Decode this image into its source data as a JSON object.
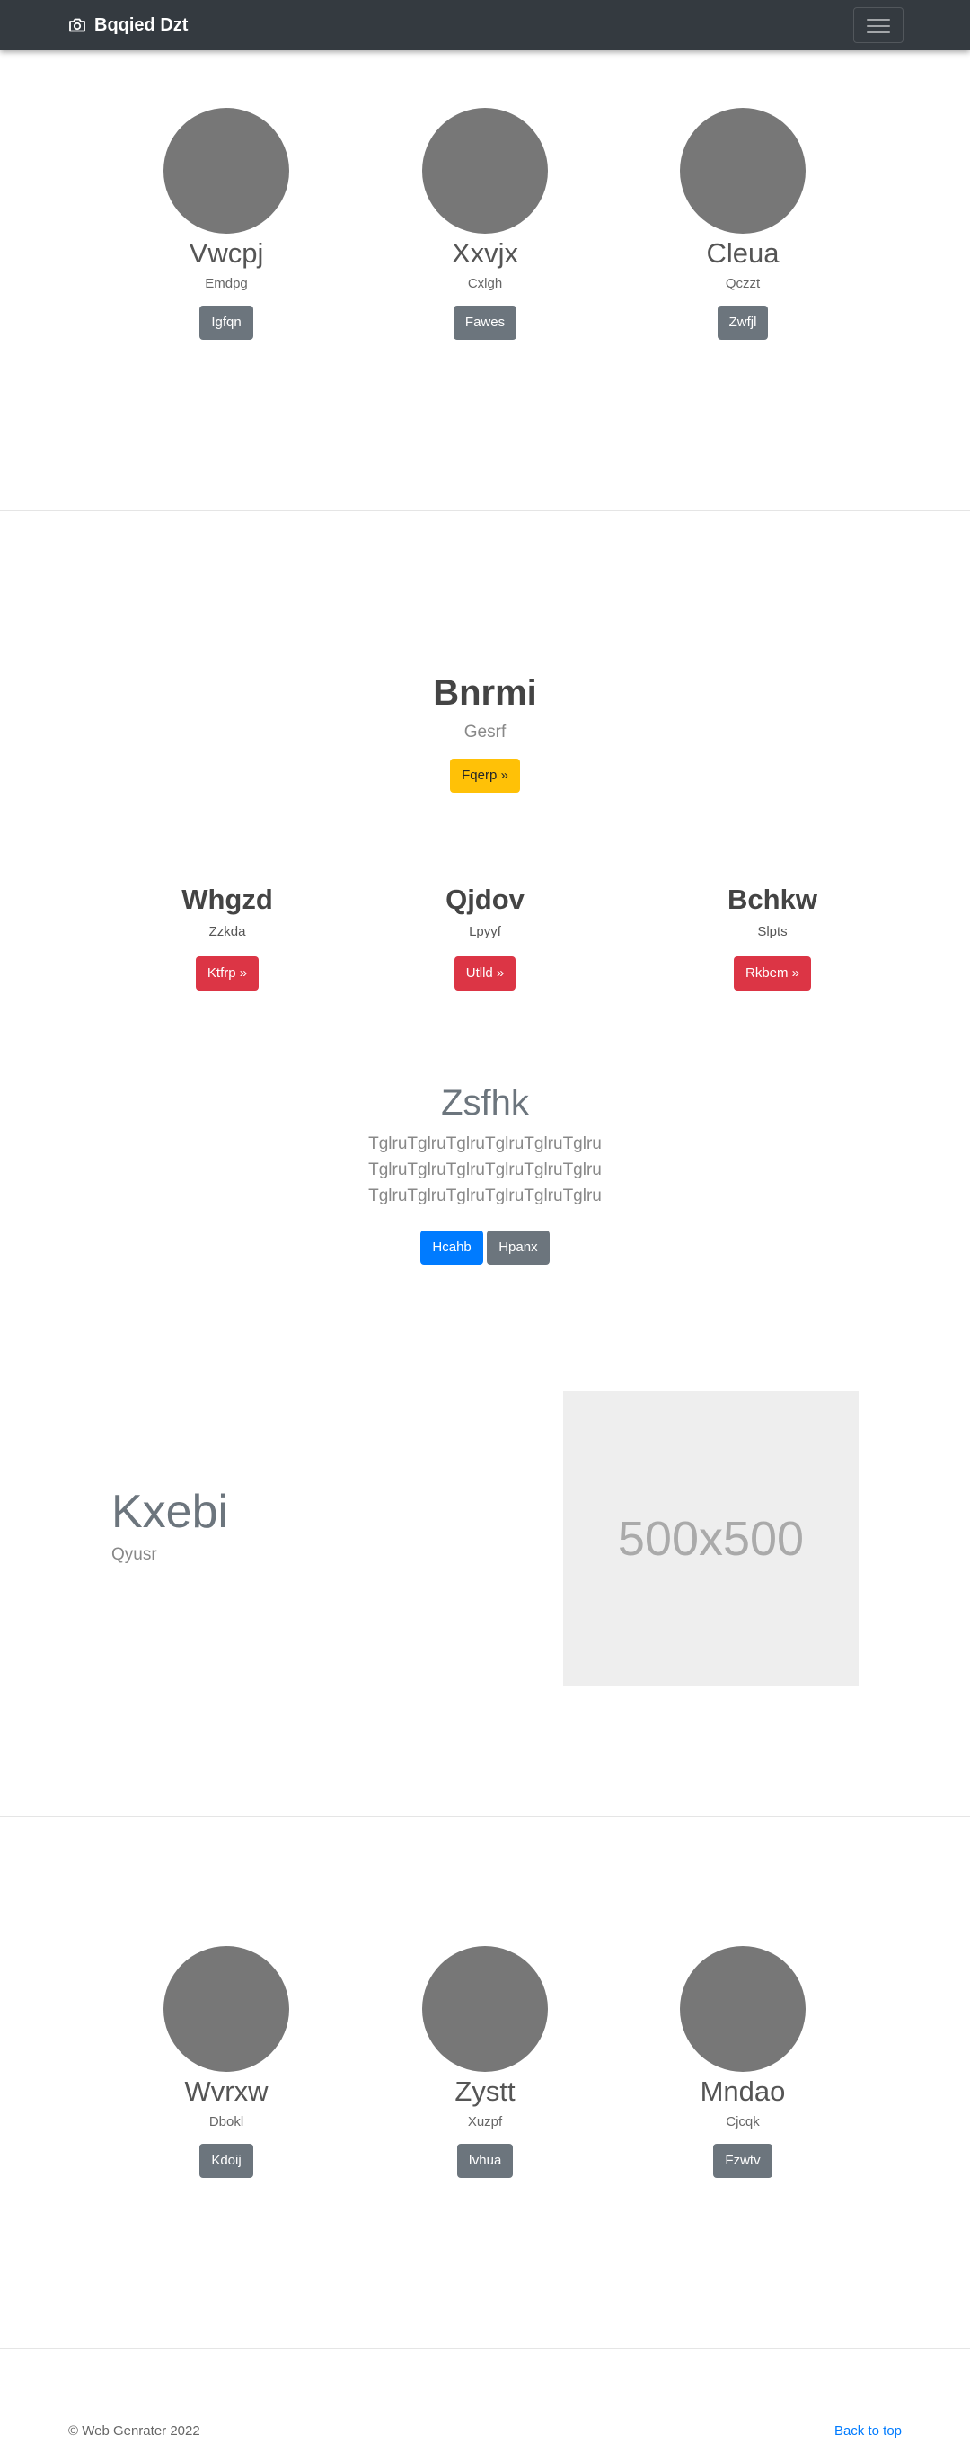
{
  "navbar": {
    "brand": "Bqqied Dzt",
    "brand_icon": "camera-icon",
    "toggle_icon": "hamburger-menu-icon"
  },
  "team_top": [
    {
      "name": "Vwcpj",
      "role": "Emdpg",
      "button": "Igfqn"
    },
    {
      "name": "Xxvjx",
      "role": "Cxlgh",
      "button": "Fawes"
    },
    {
      "name": "Cleua",
      "role": "Qczzt",
      "button": "Zwfjl"
    }
  ],
  "hero": {
    "title": "Bnrmi",
    "subtitle": "Gesrf",
    "button": "Fqerp »"
  },
  "features": [
    {
      "title": "Whgzd",
      "subtitle": "Zzkda",
      "button": "Ktfrp »"
    },
    {
      "title": "Qjdov",
      "subtitle": "Lpyyf",
      "button": "Utlld »"
    },
    {
      "title": "Bchkw",
      "subtitle": "Slpts",
      "button": "Rkbem »"
    }
  ],
  "jumbotron": {
    "title": "Zsfhk",
    "text": "TglruTglruTglruTglruTglruTglru TglruTglruTglruTglruTglruTglru TglruTglruTglruTglruTglruTglru",
    "primary_button": "Hcahb",
    "secondary_button": "Hpanx"
  },
  "featurette": {
    "title": "Kxebi",
    "subtitle": "Qyusr",
    "image_label": "500x500"
  },
  "team_bottom": [
    {
      "name": "Wvrxw",
      "role": "Dbokl",
      "button": "Kdoij"
    },
    {
      "name": "Zystt",
      "role": "Xuzpf",
      "button": "Ivhua"
    },
    {
      "name": "Mndao",
      "role": "Cjcqk",
      "button": "Fzwtv"
    }
  ],
  "footer": {
    "copyright": "© Web Genrater 2022",
    "back_to_top": "Back to top"
  },
  "colors": {
    "navbar": "#343a40",
    "secondary": "#6c757d",
    "warning": "#ffc107",
    "danger": "#dc3545",
    "primary": "#007bff"
  }
}
